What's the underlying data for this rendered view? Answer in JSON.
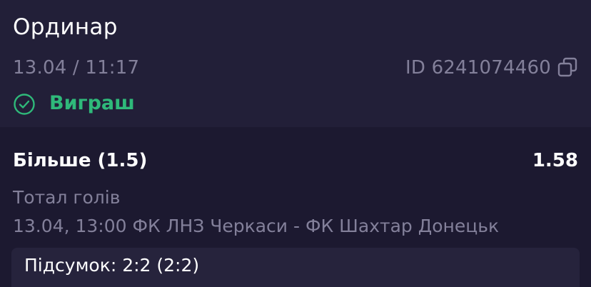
{
  "bet": {
    "type": "Ординар",
    "date": "13.04 / 11:17",
    "id": "ID 6241074460",
    "status": "Виграш",
    "status_color": "#2fb97a"
  },
  "selection": {
    "name": "Більше (1.5)",
    "odds": "1.58",
    "market": "Тотал голів",
    "event": "13.04, 13:00 ФК ЛНЗ Черкаси - ФК Шахтар Донецьк",
    "result": "Підсумок: 2:2 (2:2)"
  },
  "icons": {
    "copy": "copy-icon",
    "status": "check-circle-icon"
  }
}
